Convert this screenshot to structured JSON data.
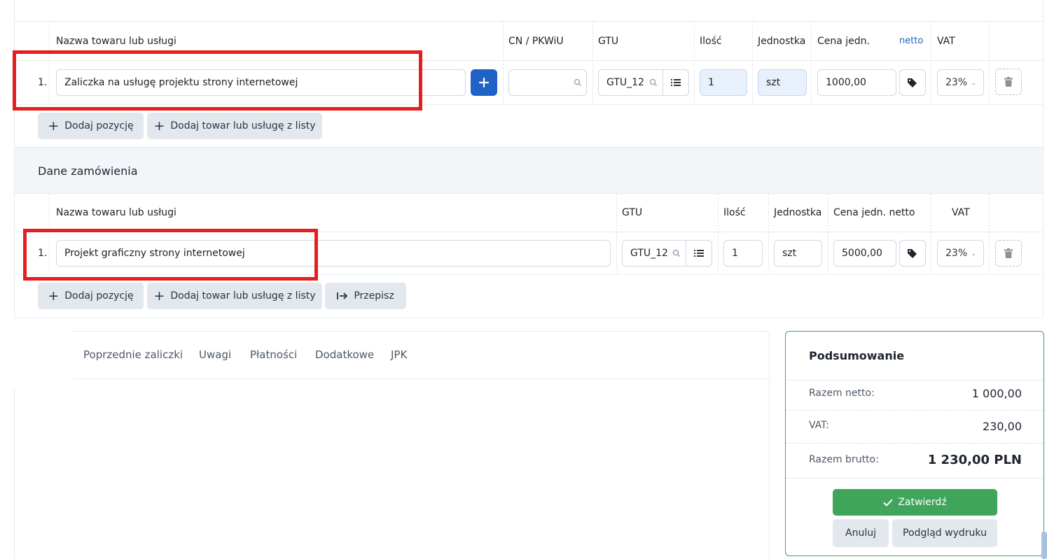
{
  "table1": {
    "headers": {
      "name": "Nazwa towaru lub usługi",
      "cn": "CN / PKWiU",
      "gtu": "GTU",
      "qty": "Ilość",
      "unit": "Jednostka",
      "price": "Cena jedn.",
      "netto": "netto",
      "vat": "VAT"
    },
    "row": {
      "index": "1.",
      "name": "Zaliczka na usługę projektu strony internetowej",
      "cn": "",
      "gtu": "GTU_12",
      "qty": "1",
      "unit": "szt",
      "price": "1000,00",
      "vat": "23%"
    },
    "add_position": "Dodaj pozycję",
    "add_from_list": "Dodaj towar lub usługę z listy"
  },
  "order": {
    "title": "Dane zamówienia",
    "headers": {
      "name": "Nazwa towaru lub usługi",
      "gtu": "GTU",
      "qty": "Ilość",
      "unit": "Jednostka",
      "price": "Cena jedn. netto",
      "vat": "VAT"
    },
    "row": {
      "index": "1.",
      "name": "Projekt graficzny strony internetowej",
      "gtu": "GTU_12",
      "qty": "1",
      "unit": "szt",
      "price": "5000,00",
      "vat": "23%"
    },
    "add_position": "Dodaj pozycję",
    "add_from_list": "Dodaj towar lub usługę z listy",
    "rewrite": "Przepisz"
  },
  "tabs": [
    "Poprzednie zaliczki",
    "Uwagi",
    "Płatności",
    "Dodatkowe",
    "JPK"
  ],
  "summary": {
    "title": "Podsumowanie",
    "net_label": "Razem netto:",
    "net_value": "1 000,00",
    "vat_label": "VAT:",
    "vat_value": "230,00",
    "gross_label": "Razem brutto:",
    "gross_value": "1 230,00 PLN",
    "confirm": "Zatwierdź",
    "cancel": "Anuluj",
    "preview": "Podgląd wydruku"
  },
  "colors": {
    "primary": "#1f63c6",
    "success": "#3fa55b",
    "highlight": "#e3201f"
  }
}
